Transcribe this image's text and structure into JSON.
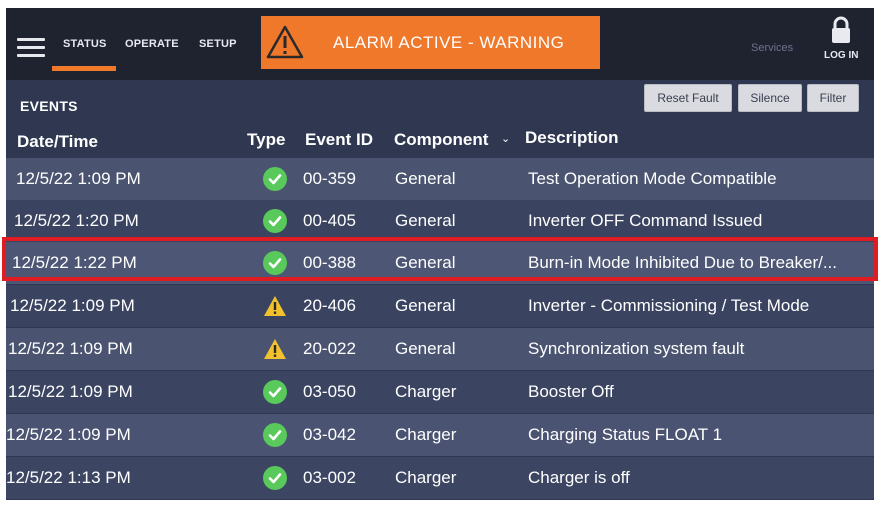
{
  "topbar": {
    "tabs": [
      {
        "label": "STATUS",
        "active": true
      },
      {
        "label": "OPERATE",
        "active": false
      },
      {
        "label": "SETUP",
        "active": false
      }
    ],
    "alarm_text": "ALARM ACTIVE - WARNING",
    "alarm_icon": "warning-triangle-icon",
    "services_label": "Services",
    "login_label": "LOG IN",
    "accent_color": "#f0782a"
  },
  "events": {
    "title": "EVENTS",
    "buttons": {
      "reset_fault": "Reset Fault",
      "silence": "Silence",
      "filter": "Filter"
    },
    "columns": {
      "datetime": "Date/Time",
      "type": "Type",
      "event_id": "Event ID",
      "component": "Component",
      "description": "Description"
    },
    "rows": [
      {
        "datetime": "12/5/22 1:09 PM",
        "type": "ok",
        "event_id": "00-359",
        "component": "General",
        "description": "Test Operation Mode Compatible"
      },
      {
        "datetime": "12/5/22 1:20 PM",
        "type": "ok",
        "event_id": "00-405",
        "component": "General",
        "description": "Inverter OFF Command Issued"
      },
      {
        "datetime": "12/5/22 1:22 PM",
        "type": "ok",
        "event_id": "00-388",
        "component": "General",
        "description": "Burn-in Mode Inhibited Due to Breaker/..."
      },
      {
        "datetime": "12/5/22 1:09 PM",
        "type": "warning",
        "event_id": "20-406",
        "component": "General",
        "description": "Inverter - Commissioning / Test Mode"
      },
      {
        "datetime": "12/5/22 1:09 PM",
        "type": "warning",
        "event_id": "20-022",
        "component": "General",
        "description": "Synchronization system fault"
      },
      {
        "datetime": "12/5/22 1:09 PM",
        "type": "ok",
        "event_id": "03-050",
        "component": "Charger",
        "description": "Booster Off"
      },
      {
        "datetime": "12/5/22 1:09 PM",
        "type": "ok",
        "event_id": "03-042",
        "component": "Charger",
        "description": "Charging Status FLOAT 1"
      },
      {
        "datetime": "12/5/22 1:13 PM",
        "type": "ok",
        "event_id": "03-002",
        "component": "Charger",
        "description": "Charger is off"
      }
    ],
    "highlighted_row": 2,
    "highlight_color": "#e11b22",
    "ok_color": "#58c95a",
    "warning_color": "#f2c12e"
  }
}
